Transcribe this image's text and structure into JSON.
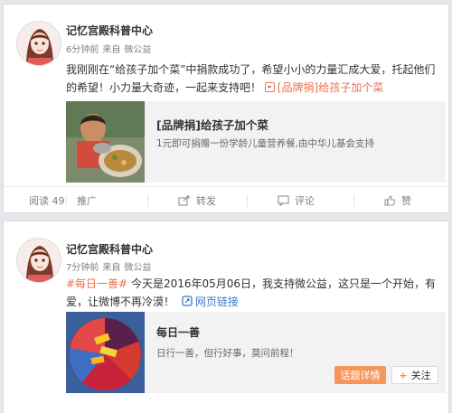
{
  "posts": [
    {
      "author": "记忆宫殿科普中心",
      "time": "6分钟前",
      "source_prefix": "来自",
      "source": "微公益",
      "text_before": "我刚刚在“给孩子加个菜”中捐款成功了，希望小小的力量汇成大爱，托起他们的希望！小力量大奇迹，一起来支持吧！",
      "link_text": "[品牌捐]给孩子加个菜",
      "card": {
        "title": "[品牌捐]给孩子加个菜",
        "desc": "1元即可捐赠一份学龄儿童营养餐,由中华儿基会支持"
      },
      "actions": {
        "read": "阅读 49",
        "promote": "推广",
        "forward": "转发",
        "comment": "评论",
        "like": "赞"
      }
    },
    {
      "author": "记忆宫殿科普中心",
      "time": "7分钟前",
      "source_prefix": "来自",
      "source": "微公益",
      "hashtag": "#每日一善#",
      "text_after": " 今天是2016年05月06日，我支持微公益，这只是一个开始，有爱，让微博不再冷漠！",
      "link_text": "网页链接",
      "card": {
        "title": "每日一善",
        "desc": "日行一善，但行好事，莫问前程！",
        "detail_button": "话题详情",
        "follow_button": "关注"
      }
    }
  ],
  "colors": {
    "link": "#eb7350",
    "detail_button": "#f7965a",
    "background": "#e4e8ec"
  }
}
